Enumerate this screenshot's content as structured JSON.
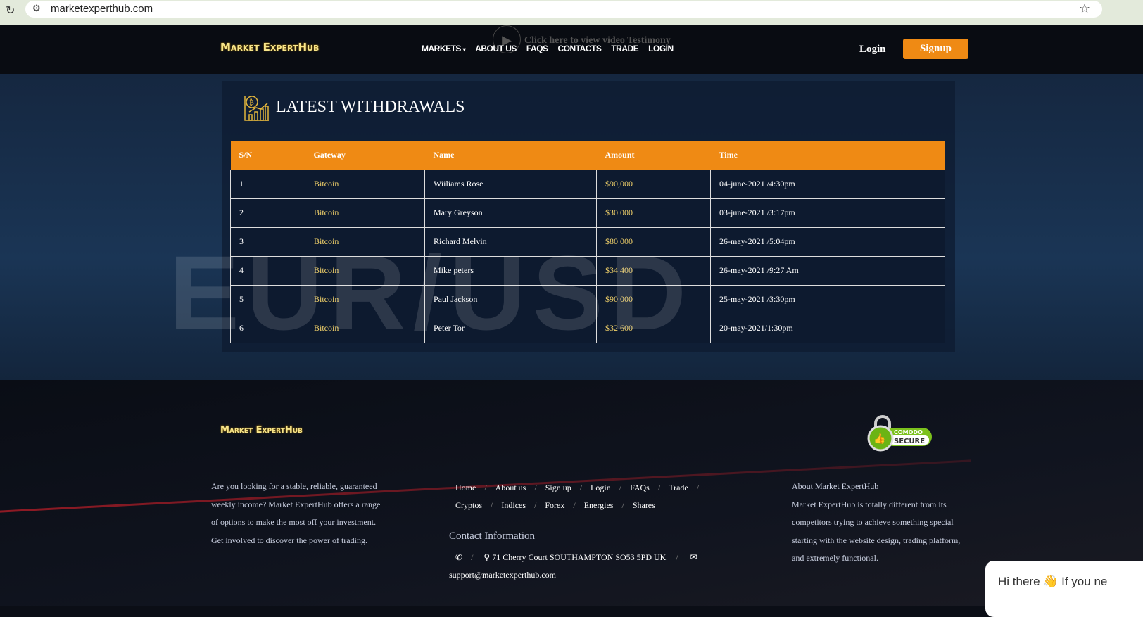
{
  "browser": {
    "url": "marketexperthub.com"
  },
  "header": {
    "logo": "Market ExpertHub",
    "video_text": "Click here to view video Testimony",
    "nav": [
      "MARKETS",
      "ABOUT US",
      "FAQS",
      "CONTACTS",
      "TRADE",
      "LOGIN"
    ],
    "login": "Login",
    "signup": "Signup"
  },
  "main": {
    "title": "LATEST WITHDRAWALS",
    "background_text": "EUR/USD",
    "columns": [
      "S/N",
      "Gateway",
      "Name",
      "Amount",
      "Time"
    ],
    "rows": [
      [
        "1",
        "Bitcoin",
        "Wiiliams Rose",
        "$90,000",
        "04-june-2021 /4:30pm"
      ],
      [
        "2",
        "Bitcoin",
        "Mary Greyson",
        "$30 000",
        "03-june-2021 /3:17pm"
      ],
      [
        "3",
        "Bitcoin",
        "Richard Melvin",
        "$80 000",
        "26-may-2021 /5:04pm"
      ],
      [
        "4",
        "Bitcoin",
        "Mike peters",
        "$34 400",
        "26-may-2021 /9:27 Am"
      ],
      [
        "5",
        "Bitcoin",
        "Paul Jackson",
        "$90 000",
        "25-may-2021 /3:30pm"
      ],
      [
        "6",
        "Bitcoin",
        "Peter Tor",
        "$32 600",
        "20-may-2021/1:30pm"
      ]
    ]
  },
  "footer": {
    "logo": "Market ExpertHub",
    "badge": "COMODO SECURE",
    "intro": [
      "Are you looking for a stable, reliable, guaranteed",
      "weekly income? Market ExpertHub offers a range",
      "of options to make the most off your investment.",
      "Get involved to discover the power of trading."
    ],
    "links_row1": [
      "Home",
      "About us",
      "Sign up",
      "Login",
      "FAQs",
      "Trade"
    ],
    "links_row2": [
      "Cryptos",
      "Indices",
      "Forex",
      "Energies",
      "Shares"
    ],
    "contact_title": "Contact Information",
    "address": "71 Cherry Court SOUTHAMPTON SO53 5PD UK",
    "email": "support@marketexperthub.com",
    "about_title": "About Market ExpertHub",
    "about": [
      "Market ExpertHub is totally different from its",
      "competitors trying to achieve something special",
      "starting with the website design, trading platform,",
      "and extremely functional."
    ]
  },
  "chat": {
    "text": "Hi there 👋 If you ne"
  }
}
